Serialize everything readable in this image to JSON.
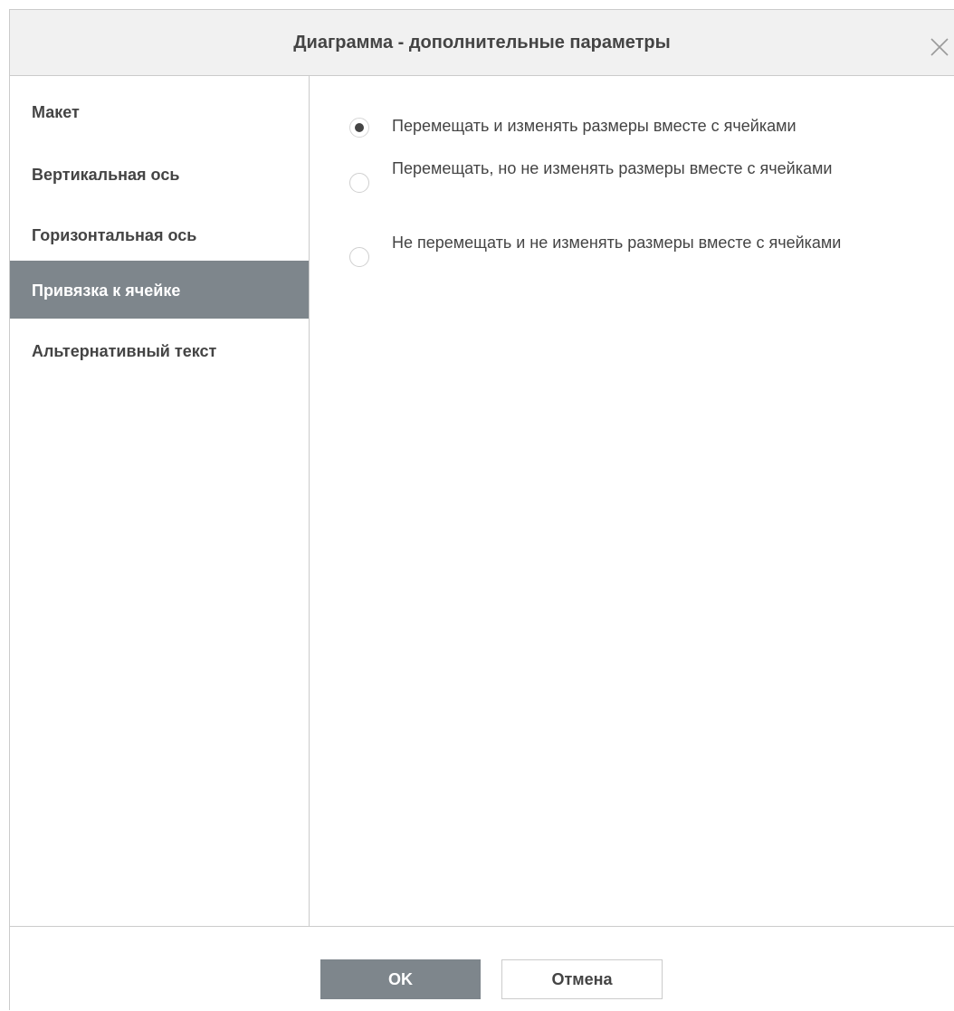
{
  "dialog": {
    "title": "Диаграмма - дополнительные параметры"
  },
  "sidebar": {
    "items": [
      {
        "label": "Макет",
        "active": false
      },
      {
        "label": "Вертикальная ось",
        "active": false
      },
      {
        "label": "Горизонтальная ось",
        "active": false
      },
      {
        "label": "Привязка к ячейке",
        "active": true
      },
      {
        "label": "Альтернативный текст",
        "active": false
      }
    ]
  },
  "snap": {
    "options": [
      {
        "label": "Перемещать и изменять размеры вместе с ячейками",
        "checked": true
      },
      {
        "label": "Перемещать, но не изменять размеры вместе с ячейками",
        "checked": false
      },
      {
        "label": "Не перемещать и не изменять размеры вместе с ячейками",
        "checked": false
      }
    ]
  },
  "footer": {
    "ok_label": "OK",
    "cancel_label": "Отмена"
  },
  "colors": {
    "accent": "#7e868c",
    "text": "#444444",
    "header_bg": "#f1f1f1",
    "border": "#cbcbcb"
  },
  "icons": {
    "close": "close-icon"
  }
}
